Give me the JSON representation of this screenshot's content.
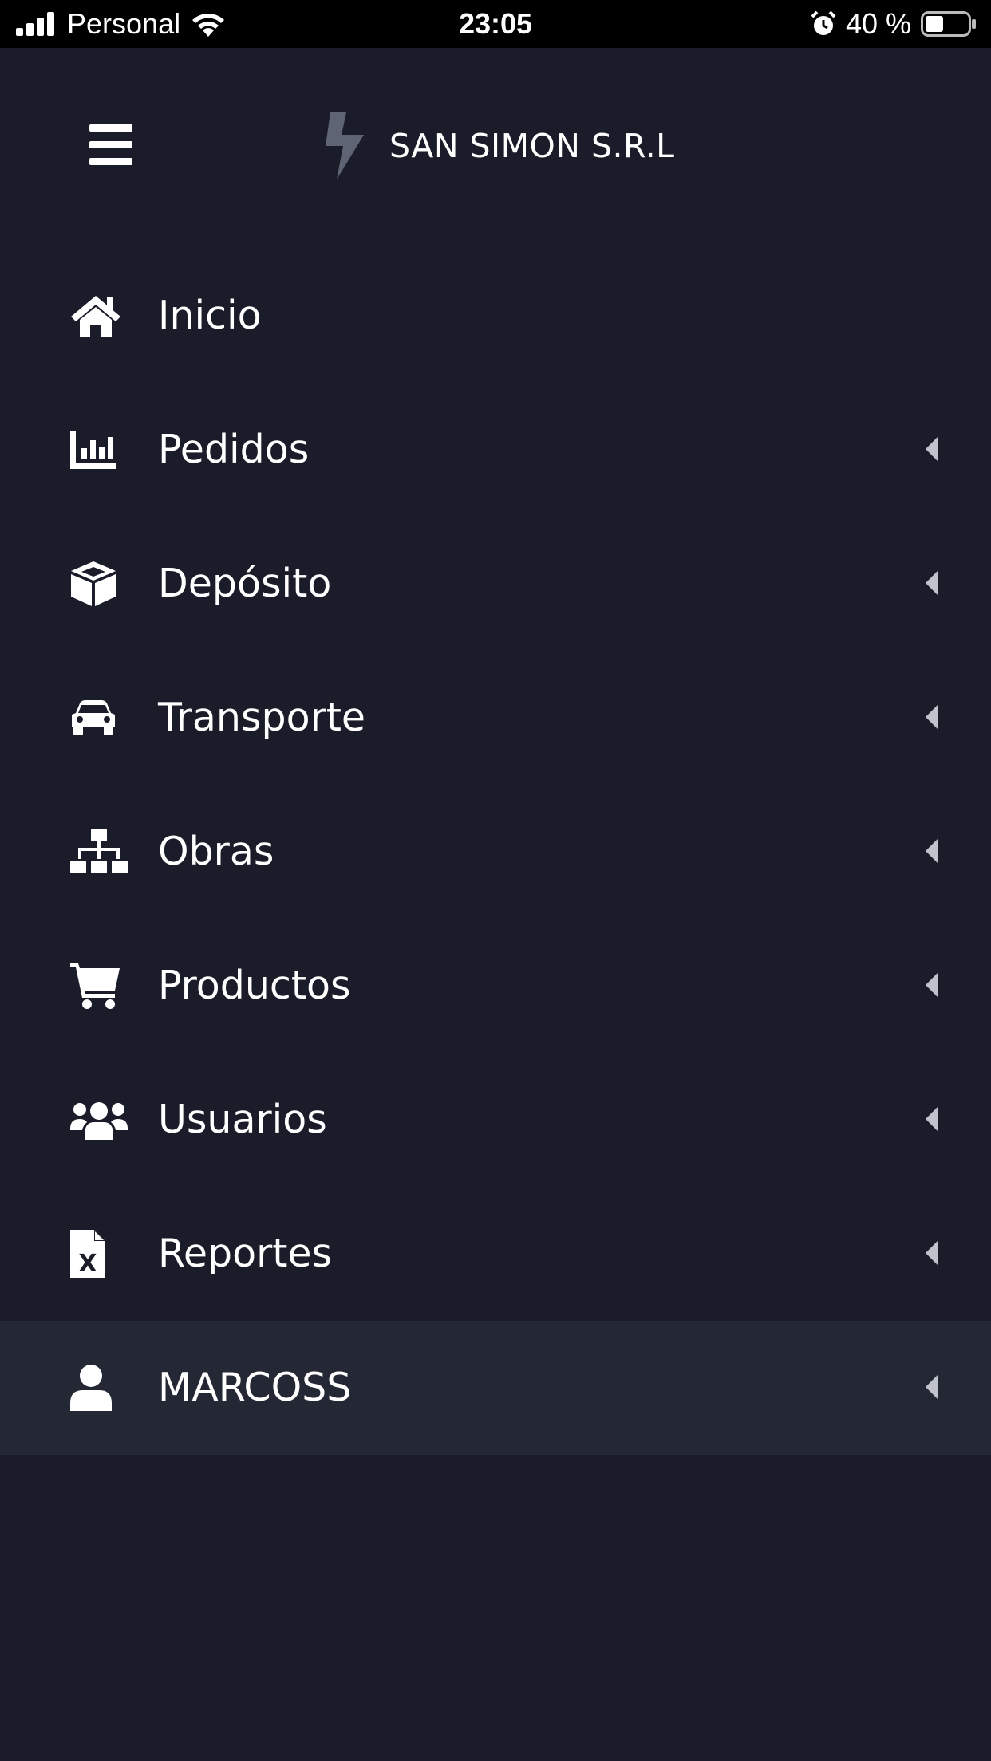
{
  "status_bar": {
    "carrier": "Personal",
    "time": "23:05",
    "battery": "40 %"
  },
  "header": {
    "brand": "SAN SIMON S.R.L",
    "logo_color": "#5f6475"
  },
  "menu": {
    "items": [
      {
        "label": "Inicio",
        "icon": "home-icon",
        "has_submenu": false
      },
      {
        "label": "Pedidos",
        "icon": "chart-bar-icon",
        "has_submenu": true
      },
      {
        "label": "Depósito",
        "icon": "box-icon",
        "has_submenu": true
      },
      {
        "label": "Transporte",
        "icon": "car-icon",
        "has_submenu": true
      },
      {
        "label": "Obras",
        "icon": "sitemap-icon",
        "has_submenu": true
      },
      {
        "label": "Productos",
        "icon": "cart-icon",
        "has_submenu": true
      },
      {
        "label": "Usuarios",
        "icon": "users-icon",
        "has_submenu": true
      },
      {
        "label": "Reportes",
        "icon": "excel-file-icon",
        "has_submenu": true
      },
      {
        "label": "MARCOSS",
        "icon": "user-icon",
        "has_submenu": true,
        "active": true
      }
    ]
  }
}
